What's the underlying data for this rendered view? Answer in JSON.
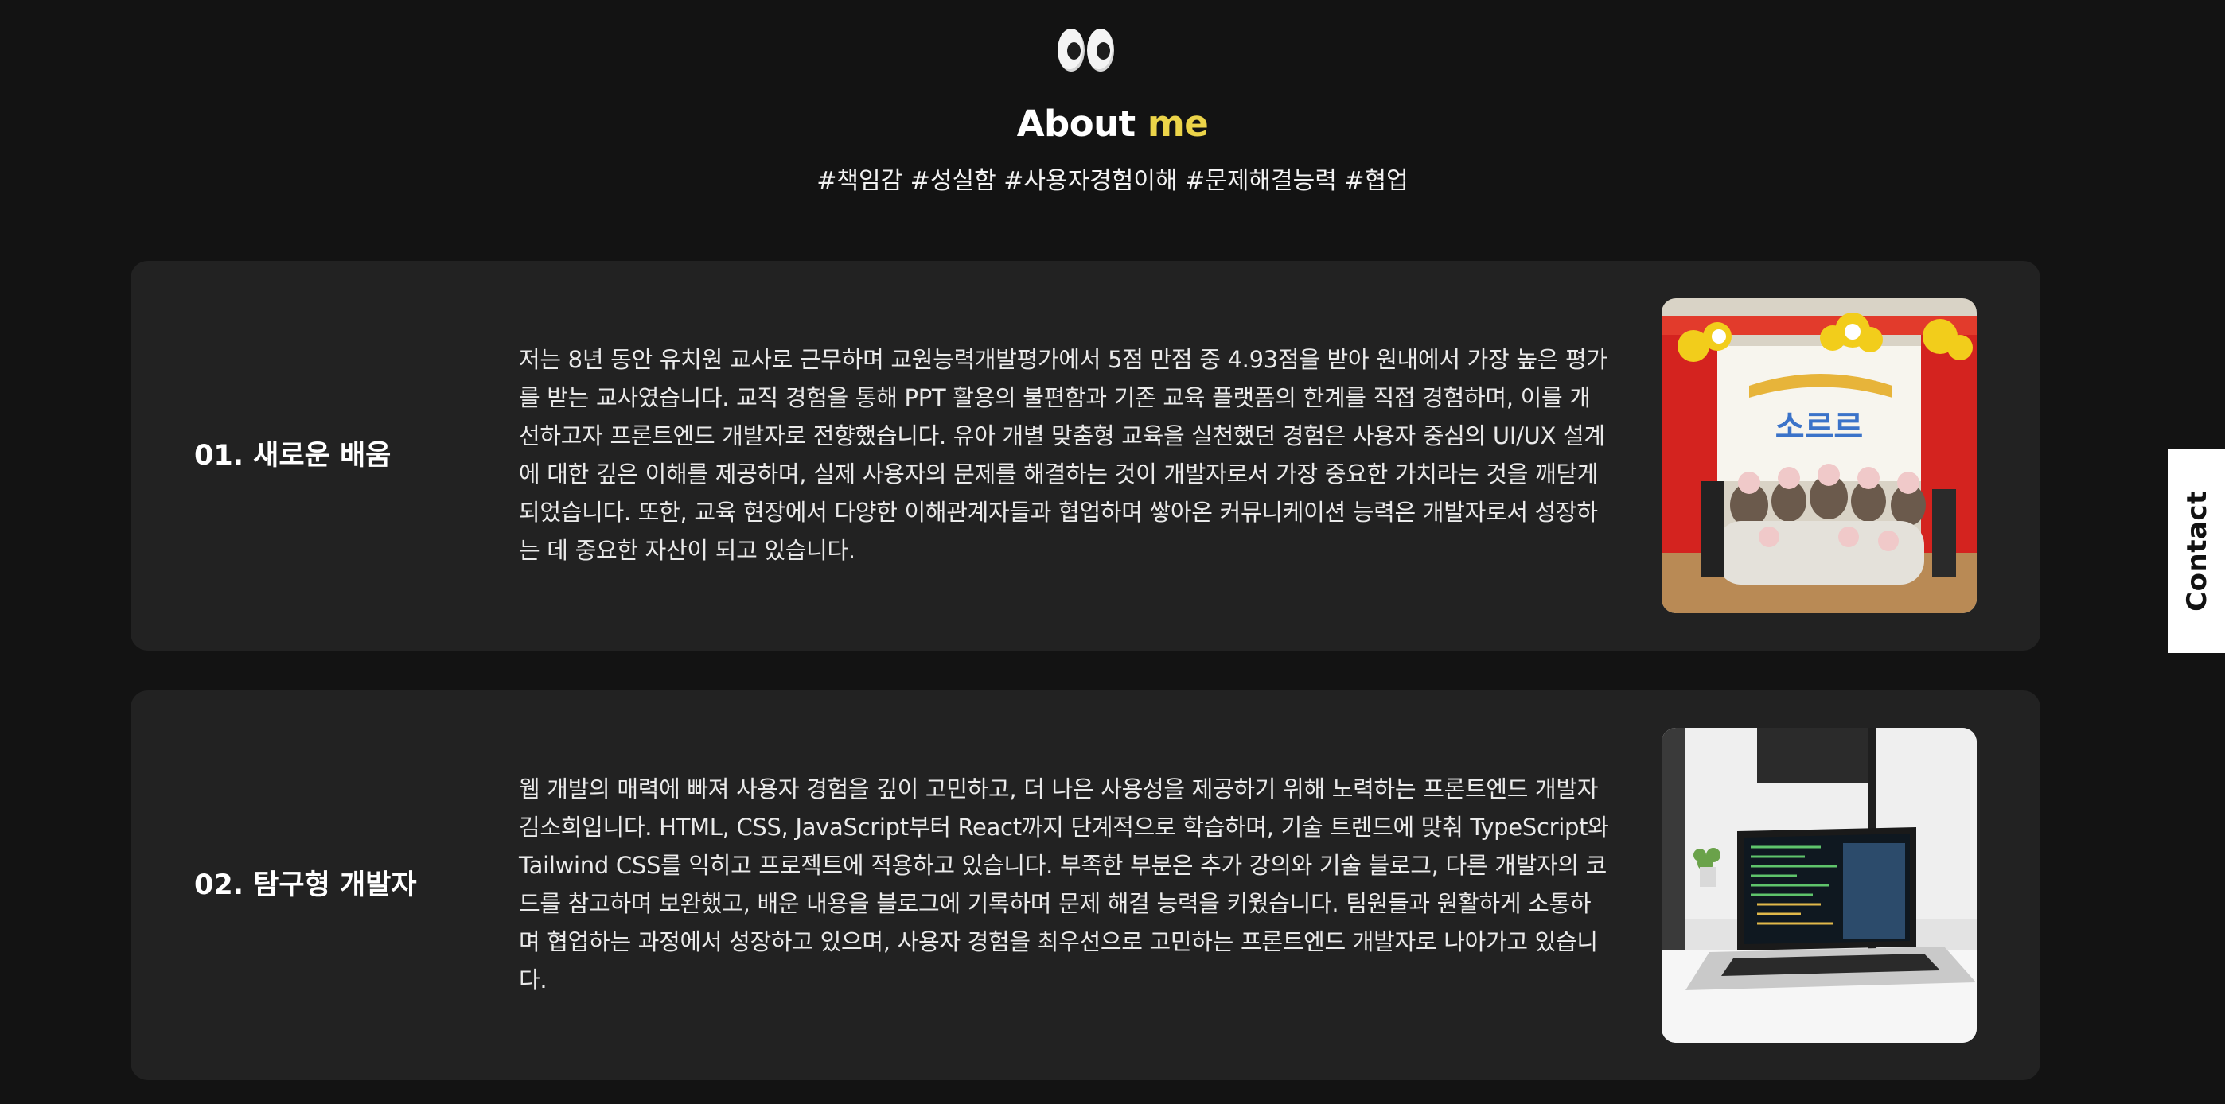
{
  "header": {
    "icon": "eyes-emoji",
    "title_main": "About",
    "title_accent": "me",
    "accent_color": "#ecd449",
    "tags": "#책임감 #성실함 #사용자경험이해 #문제해결능력 #협업"
  },
  "cards": [
    {
      "title": "01. 새로운 배움",
      "body": "저는 8년 동안 유치원 교사로 근무하며 교원능력개발평가에서 5점 만점 중 4.93점을 받아 원내에서 가장 높은 평가를 받는 교사였습니다. 교직 경험을 통해 PPT 활용의 불편함과 기존 교육 플랫폼의 한계를 직접 경험하며, 이를 개선하고자 프론트엔드 개발자로 전향했습니다. 유아 개별 맞춤형 교육을 실천했던 경험은 사용자 중심의 UI/UX 설계에 대한 깊은 이해를 제공하며, 실제 사용자의 문제를 해결하는 것이 개발자로서 가장 중요한 가치라는 것을 깨닫게 되었습니다. 또한, 교육 현장에서 다양한 이해관계자들과 협업하며 쌓아온 커뮤니케이션 능력은 개발자로서 성장하는 데 중요한 자산이 되고 있습니다.",
      "image_banner_text": "소르르"
    },
    {
      "title": "02. 탐구형 개발자",
      "body": "웹 개발의 매력에 빠져 사용자 경험을 깊이 고민하고, 더 나은 사용성을 제공하기 위해 노력하는 프론트엔드 개발자 김소희입니다. HTML, CSS, JavaScript부터 React까지 단계적으로 학습하며, 기술 트렌드에 맞춰 TypeScript와 Tailwind CSS를 익히고 프로젝트에 적용하고 있습니다. 부족한 부분은 추가 강의와 기술 블로그, 다른 개발자의 코드를 참고하며 보완했고, 배운 내용을 블로그에 기록하며 문제 해결 능력을 키웠습니다. 팀원들과 원활하게 소통하며 협업하는 과정에서 성장하고 있으며, 사용자 경험을 최우선으로 고민하는 프론트엔드 개발자로 나아가고 있습니다."
    }
  ],
  "contact_label": "Contact"
}
